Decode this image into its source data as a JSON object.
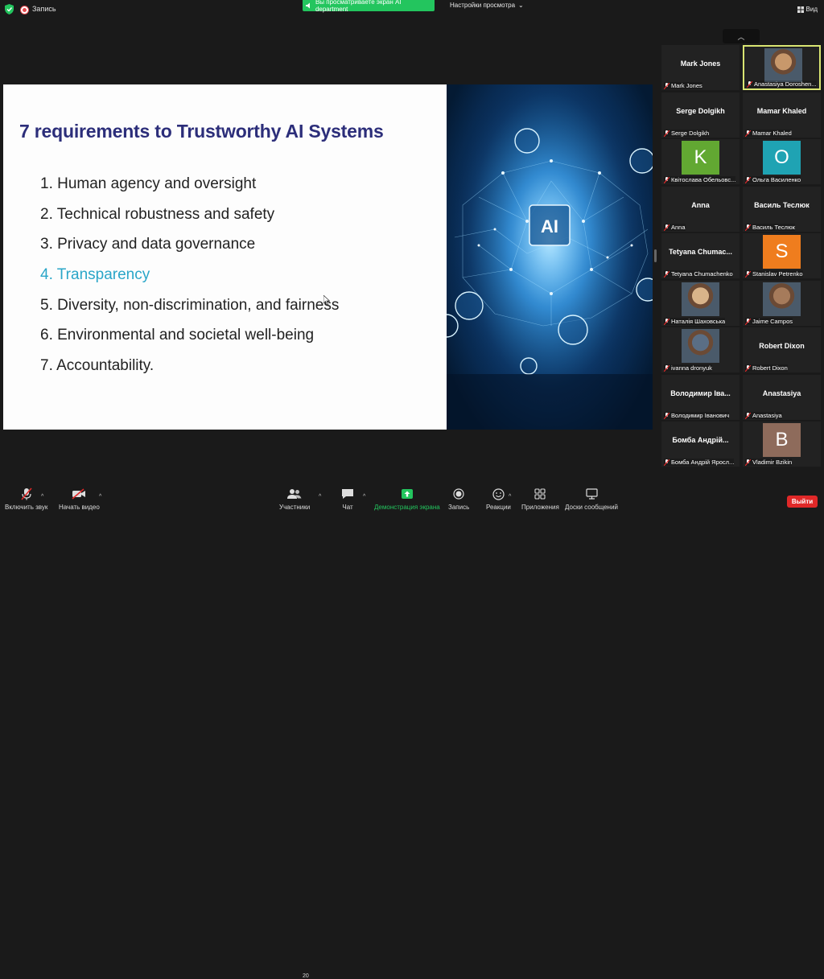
{
  "topbar": {
    "recording_label": "Запись",
    "share_notice": "Вы просматриваете экран AI department",
    "view_settings": "Настройки просмотра",
    "view_button": "Вид"
  },
  "slide": {
    "title": "7 requirements to Trustworthy AI Systems",
    "items": [
      "1. Human agency and oversight",
      "2. Technical robustness and safety",
      "3. Privacy and data governance",
      "4. Transparency",
      "5. Diversity, non-discrimination, and fairness",
      "6. Environmental and societal well-being",
      "7. Accountability."
    ],
    "highlight_index": 3,
    "image_text": "AI"
  },
  "participants": [
    {
      "big": "Mark Jones",
      "label": "Mark Jones"
    },
    {
      "label": "Anastasiya Doroshen...",
      "photo": true,
      "active": true
    },
    {
      "big": "Serge Dolgikh",
      "label": "Serge Dolgikh"
    },
    {
      "big": "Mamar Khaled",
      "label": "Mamar Khaled"
    },
    {
      "letter": "K",
      "color": "#62a832",
      "label": "Квітослава Обельовс..."
    },
    {
      "letter": "O",
      "color": "#1fa3b3",
      "label": "Ольга Василенко"
    },
    {
      "big": "Anna",
      "label": "Anna"
    },
    {
      "big": "Василь Теслюк",
      "label": "Василь Теслюк"
    },
    {
      "big": "Tetyana Chumac...",
      "label": "Tetyana Chumachenko"
    },
    {
      "letter": "S",
      "color": "#ef7d1e",
      "label": "Stanislav Petrenko"
    },
    {
      "label": "Наталія Шаховська",
      "photo": true
    },
    {
      "label": "Jaime Campos",
      "photo": true
    },
    {
      "label": "ivanna dronyuk",
      "photo": true
    },
    {
      "big": "Robert Dixon",
      "label": "Robert Dixon"
    },
    {
      "big": "Володимир Іва...",
      "label": "Володимир Іванович"
    },
    {
      "big": "Anastasiya",
      "label": "Anastasiya"
    },
    {
      "big": "Бомба Андрій...",
      "label": "Бомба Андрій Яросл..."
    },
    {
      "letter": "B",
      "color": "#8e6b5b",
      "label": "Vladimir Bzikin"
    }
  ],
  "toolbar": {
    "mute": "Включить звук",
    "video": "Начать видео",
    "participants": "Участники",
    "participants_count": "20",
    "chat": "Чат",
    "share": "Демонстрация экрана",
    "record": "Запись",
    "reactions": "Реакции",
    "apps": "Приложения",
    "whiteboards": "Доски сообщений",
    "leave": "Выйти"
  },
  "colors": {
    "green": "#23c55e",
    "title_blue": "#2c2e7a",
    "highlight": "#2aa6c8",
    "leave_red": "#e02828",
    "active_border": "#d9e572"
  }
}
